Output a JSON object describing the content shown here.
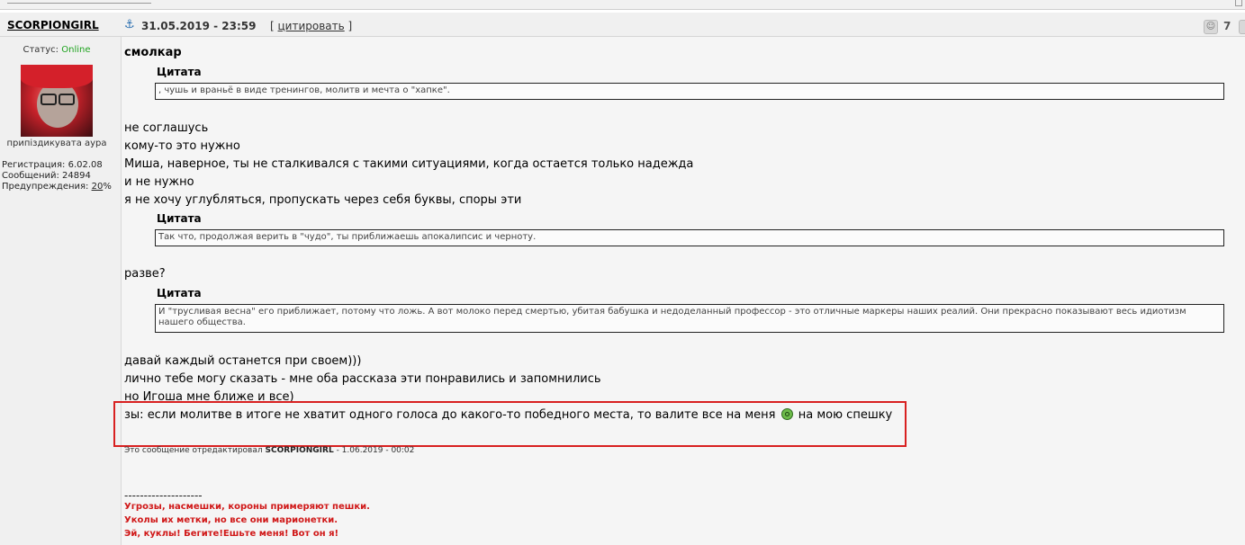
{
  "post": {
    "author": "SCORPIONGIRL",
    "status_label": "Статус:",
    "status_value": "Online",
    "user_rank": "припіздикувата аура",
    "stats": {
      "registration": "Регистрация: 6.02.08",
      "messages": "Сообщений: 24894",
      "warnings_label": "Предупреждения:",
      "warnings_value": "20",
      "warnings_unit": "%"
    },
    "date": "31.05.2019 - 23:59",
    "quote_bracket_open": "[",
    "quote_link": "цитировать",
    "quote_bracket_close": "]",
    "rep_count": "7"
  },
  "body": {
    "opener": "смолкар",
    "quote_title": "Цитата",
    "quote1": ", чушь и враньё в виде тренингов, молитв и мечта о \"хапке\".",
    "para1": [
      "не соглашусь",
      "кому-то это нужно",
      "Миша, наверное, ты не сталкивался с такими ситуациями, когда остается только надежда",
      "и не нужно",
      "я не хочу углубляться, пропускать через себя буквы, споры эти"
    ],
    "quote2": "Так что, продолжая верить в \"чудо\", ты приближаешь апокалипсис и черноту.",
    "para2": "разве?",
    "quote3": "И \"трусливая весна\" его приближает, потому что ложь. А вот молоко перед смертью, убитая бабушка и недоделанный профессор - это отличные маркеры наших реалий. Они прекрасно показывают весь идиотизм нашего общества.",
    "para3": [
      "давай каждый останется при своем)))",
      "лично тебе могу сказать - мне оба рассказа эти понравились и запомнились",
      "но Игоша мне ближе и все)"
    ],
    "ps_before": "зы: если молитве в итоге не хватит одного голоса до какого-то победного места, то валите все на меня",
    "ps_after": "на мою спешку",
    "edited_prefix": "Это сообщение отредактировал",
    "edited_author": "SCORPIONGIRL",
    "edited_date": "- 1.06.2019 - 00:02"
  },
  "signature": {
    "separator": "--------------------",
    "lines": [
      "Угрозы, насмешки, короны примеряют пешки.",
      "Уколы их метки, но все они марионетки.",
      "Эй, куклы! Бегите!Ешьте меня! Вот он я!"
    ]
  },
  "colors": {
    "online": "#1fa31f",
    "signature": "#d01818",
    "highlight": "#d82020"
  },
  "icons": {
    "anchor": "anchor-icon",
    "rep": "reputation-icon",
    "smiley": "smiley-icon"
  }
}
